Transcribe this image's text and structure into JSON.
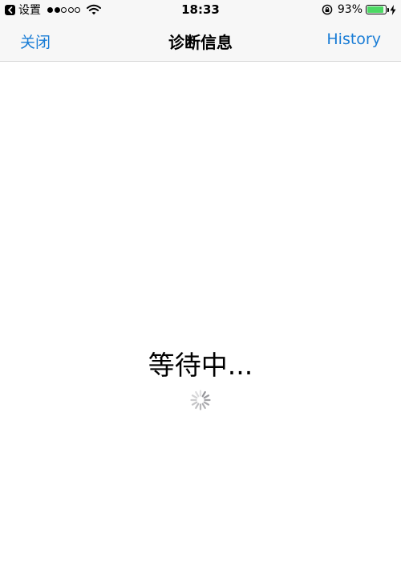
{
  "status_bar": {
    "back_app_label": "设置",
    "time": "18:33",
    "battery_percent_text": "93%",
    "battery_level": 0.93,
    "signal_bars_filled": 2,
    "signal_bars_total": 5
  },
  "nav": {
    "left_label": "关闭",
    "title": "诊断信息",
    "right_label": "History"
  },
  "content": {
    "waiting_text": "等待中..."
  },
  "colors": {
    "accent": "#1a7dd6",
    "battery": "#4cd964",
    "bar_background": "#f7f7f7"
  },
  "icons": {
    "back_app": "chevron-left-icon",
    "wifi": "wifi-icon",
    "orientation_lock": "orientation-lock-icon",
    "battery": "battery-icon",
    "charging": "bolt-icon",
    "loading": "spinner-icon"
  }
}
